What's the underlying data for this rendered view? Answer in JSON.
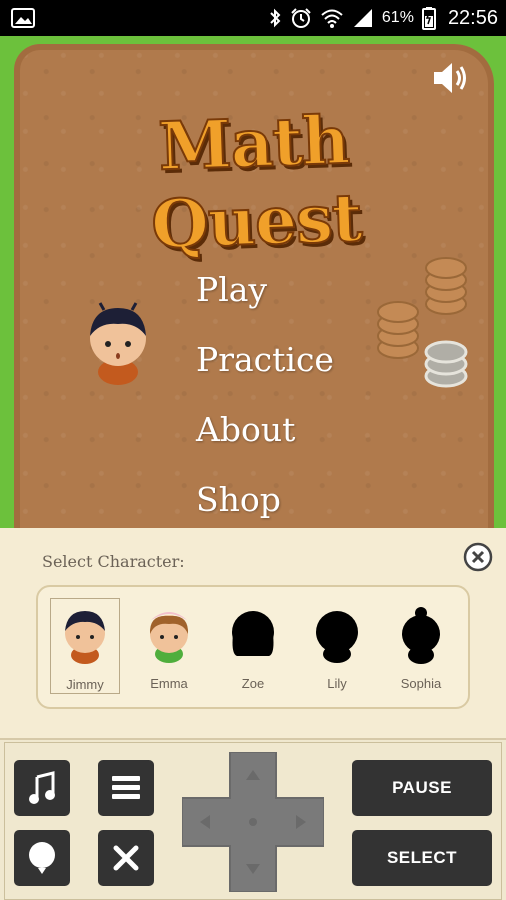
{
  "status_bar": {
    "battery_percent": "61%",
    "time": "22:56",
    "icons": [
      "image-notification-icon",
      "bluetooth-icon",
      "alarm-icon",
      "wifi-icon",
      "signal-icon",
      "battery-icon"
    ]
  },
  "game": {
    "title": "Math Quest",
    "menu": {
      "play": "Play",
      "practice": "Practice",
      "about": "About",
      "shop": "Shop"
    },
    "colors": {
      "grass": "#6cc13c",
      "dirt": "#b07a4c",
      "title_fill": "#f0a02a"
    }
  },
  "character_panel": {
    "title": "Select Character:",
    "selected": "Jimmy",
    "characters": [
      {
        "name": "Jimmy",
        "unlocked": true
      },
      {
        "name": "Emma",
        "unlocked": true
      },
      {
        "name": "Zoe",
        "unlocked": false
      },
      {
        "name": "Lily",
        "unlocked": false
      },
      {
        "name": "Sophia",
        "unlocked": false
      }
    ]
  },
  "controller": {
    "pause_label": "PAUSE",
    "select_label": "SELECT",
    "buttons": [
      "music-icon",
      "menu-icon",
      "balloon-icon",
      "close-icon"
    ]
  }
}
